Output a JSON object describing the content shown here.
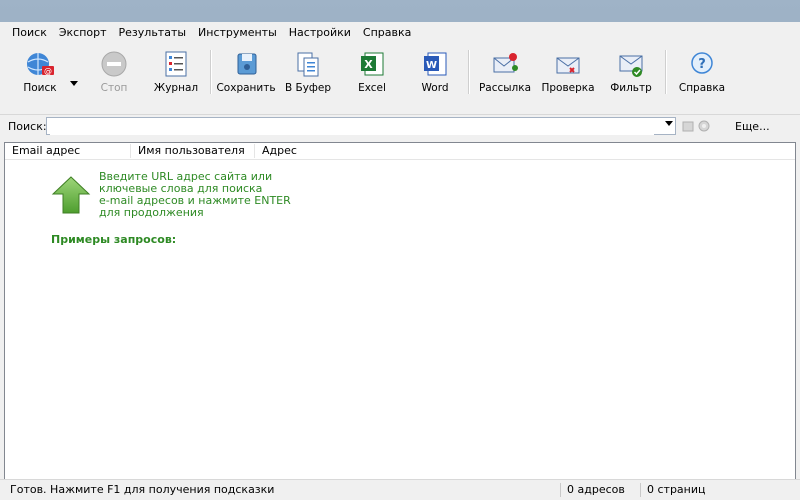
{
  "menu": {
    "items": [
      "Поиск",
      "Экспорт",
      "Результаты",
      "Инструменты",
      "Настройки",
      "Справка"
    ]
  },
  "toolbar": {
    "search": "Поиск",
    "stop": "Стоп",
    "journal": "Журнал",
    "save": "Сохранить",
    "buffer": "В Буфер",
    "excel": "Excel",
    "word": "Word",
    "mailing": "Рассылка",
    "check": "Проверка",
    "filter": "Фильтр",
    "help": "Справка"
  },
  "search": {
    "label": "Поиск:",
    "value": "",
    "more": "Еще..."
  },
  "list": {
    "columns": [
      "Email адрес",
      "Имя пользователя",
      "Адрес"
    ],
    "hint_lines": [
      "Введите URL адрес сайта или",
      "ключевые слова для поиска",
      "e-mail адресов и нажмите ENTER",
      "для продолжения"
    ],
    "examples_label": "Примеры запросов:"
  },
  "status": {
    "message": "Готов. Нажмите F1 для получения подсказки",
    "addresses": "0 адресов",
    "pages": "0 страниц"
  },
  "colors": {
    "hint_green": "#2e8a24",
    "excel_green": "#1d7a35",
    "word_blue": "#2a5ab8"
  }
}
